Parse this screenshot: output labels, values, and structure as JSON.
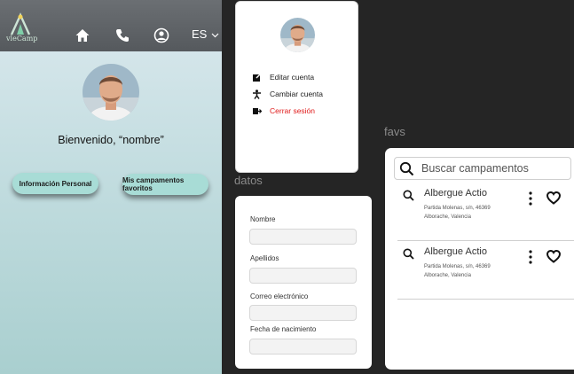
{
  "app": {
    "logo_text": "vleCamp",
    "language": "ES"
  },
  "home": {
    "welcome": "Bienvenido, “nombre”",
    "btn_personal": "Información Personal",
    "btn_favorites": "Mis campamentos favoritos"
  },
  "menu": {
    "items": [
      {
        "label": "Editar cuenta",
        "icon": "edit-icon"
      },
      {
        "label": "Cambiar cuenta",
        "icon": "person-icon"
      },
      {
        "label": "Cerrar sesión",
        "icon": "logout-icon"
      }
    ],
    "danger_color": "#e01b1b"
  },
  "datos": {
    "title": "datos",
    "fields": [
      {
        "label": "Nombre",
        "value": ""
      },
      {
        "label": "Apellidos",
        "value": ""
      },
      {
        "label": "Correo electrónico",
        "value": ""
      },
      {
        "label": "Fecha de nacimiento",
        "value": ""
      }
    ]
  },
  "favs": {
    "title": "favs",
    "search_placeholder": "Buscar campamentos",
    "items": [
      {
        "name": "Albergue Actio",
        "address_line1": "Partida Molenas, s/n, 46369",
        "address_line2": "Alborache, Valencia"
      },
      {
        "name": "Albergue Actio",
        "address_line1": "Partida Molenas, s/n, 46369",
        "address_line2": "Alborache, Valencia"
      }
    ]
  },
  "colors": {
    "accent_pill": "#a8dcd6",
    "topbar": "#5e6266"
  }
}
